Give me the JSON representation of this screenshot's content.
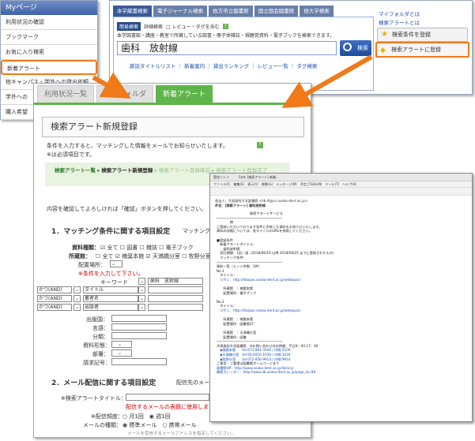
{
  "mypage": {
    "title": "Myページ",
    "items": [
      "利用状況の確認",
      "ブックマーク",
      "お気に入り検索",
      "新着アラート",
      "他キャンパス・学外への貸出依頼",
      "学外への",
      "購入希望"
    ]
  },
  "search": {
    "tabs": [
      "本学蔵書検索",
      "電子ジャーナル検索",
      "枚方市立図書館",
      "国立国会図書館",
      "他大学検索"
    ],
    "opt_simple": "簡易検索",
    "opt_detail": "詳細検索",
    "opt_review": "□ レビュー・タグを含む",
    "description": "本学図書館・講座・教室で所蔵している図書・冊子体雑誌・視聴覚資料・電子ブックを検索できます。",
    "query": "歯科　放射線",
    "search_button": "検索",
    "links": "雑誌タイトルリスト ｜ 新着案内 ｜ 貸出ランキング ｜ レビュー一覧 ｜ タグ検索",
    "myfolder_link": "マイフォルダとは",
    "alert_link": "検索アラートとは",
    "save_button": "検索条件を登録",
    "alert_button": "検索アラートに登録"
  },
  "main": {
    "tabs": [
      "利用状況一覧",
      "マイフォルダ",
      "新着アラート"
    ],
    "heading": "検索アラート新規登録",
    "intro": "条件を入力すると、マッチングした情報をメールでお知らせいたします。",
    "required_note": "※は必須項目です。",
    "steps": [
      "検索アラート一覧",
      "検索アラート新規登録",
      "検索アラート登録確認",
      "検索アラート登録完了"
    ],
    "confirm_text": "内容を確認してよろしければ「確認」ボタンを押してください。",
    "section1": "1．マッチング条件に関する項目設定",
    "section1_sub": "マッチング条件を設",
    "material_label": "資料種類：",
    "material_opts": "☑ 全て ☐ 図書 ☐ 雑誌 ☐ 電子ブック",
    "holding_label": "所蔵館：",
    "holding_opts": "☐ 全て ☑ 楠葉本館 ☑ 天満橋分室 ☐ 牧野分室",
    "location_label": "配置場所：",
    "must_input": "※条件を入力して下さい。",
    "rows": [
      {
        "op": "",
        "field": "キーワード",
        "value": "歯科　放射線"
      },
      {
        "op": "かつ(AND)",
        "field": "タイトル",
        "value": ""
      },
      {
        "op": "かつ(AND)",
        "field": "著者名",
        "value": ""
      },
      {
        "op": "かつ(AND)",
        "field": "出版者",
        "value": ""
      }
    ],
    "extra_fields": [
      "出版国：",
      "言語：",
      "分類：",
      "資料形態：",
      "部署：",
      "請求記号："
    ],
    "section2": "2．メール配信に関する項目設定",
    "section2_sub": "配信先のメールアドレス",
    "alert_title_label": "※検索アラートタイトル：",
    "alert_title_note": "配信するメールの表題に使用します。",
    "frequency_label": "※配信頻度：",
    "frequency_opts": "○ 月1回　◉ 週1回",
    "mailtype_label": "メールの種類：",
    "mailtype_opts": "◉ 標準メール　○ 携帯メール",
    "mail_note": "メールを受信するメールアドレスを指定してください。"
  },
  "mail": {
    "titlebar": "受信トレイ　　　Fwd: [検索アラート] 新着...",
    "menubar": "ファイル(F)　編集(E)　表示(V)　移動(G)　メッセージ(M)　予定とToDo(N)　ツール(T)　ヘルプ(H)",
    "from": "差出人：大阪歯科大学図書館 <lib-ill@cc.osaka-dent.ac.jp>",
    "subject": "件名：[検索アラート] 歯科放射線",
    "body_lines": [
      "　　　　　　　　　　検索アラートサービス",
      "─────────────────────────────────",
      "　　　　様",
      "ご登録いただいております条件に合致した資料をお知らせいたします。",
      "資料の詳細については、各タイトルのURLを参照してください。",
      "",
      "■登録条件",
      "　新着アラートタイトル：",
      "　　歯科放射線",
      "　実行期間：1回／週（2018/06/19 以降 2018/06/25 までに登録されたもの）",
      "　マッチング条件：",
      "─────────────────────────────────",
      "資料一覧（ヒット件数：2件）",
      "No.1",
      "　タイトル：",
      "　ＵＲＬ：http://libopac.osaka-dent.ac.jp/webopac/",
      "",
      "　　所蔵館　：楠葉本館",
      "　　配置場所：電子ブック",
      "",
      "No.2",
      "　タイトル：",
      "　ＵＲＬ：http://libopac.osaka-dent.ac.jp/webopac/",
      "",
      "　　所蔵館　：楠葉本館",
      "　　配置場所：図書館2F",
      "",
      "　　所蔵館　：天満橋分室",
      "　　配置場所：図書",
      "─────────────────────────────────",
      "大阪歯科大学図書館　※お問い合わせ対応時間：平日9：00-17：00",
      "　◆楠葉本館　　tel:072-864-3106 / 内線:3106",
      "　◆天満橋分室　tel:06-6910-1039 / 内線:1039",
      "　◆牧野分室　　tel:072-856-9914 / 内線:9914",
      "ご意見・ご要望は図書館ホームページまで",
      "図書館HP：http://www.osaka-dent.ac.jp/library/",
      "開館カレンダー：http://www.lib.osaka-dent.ac.jp/page_id=98"
    ]
  }
}
